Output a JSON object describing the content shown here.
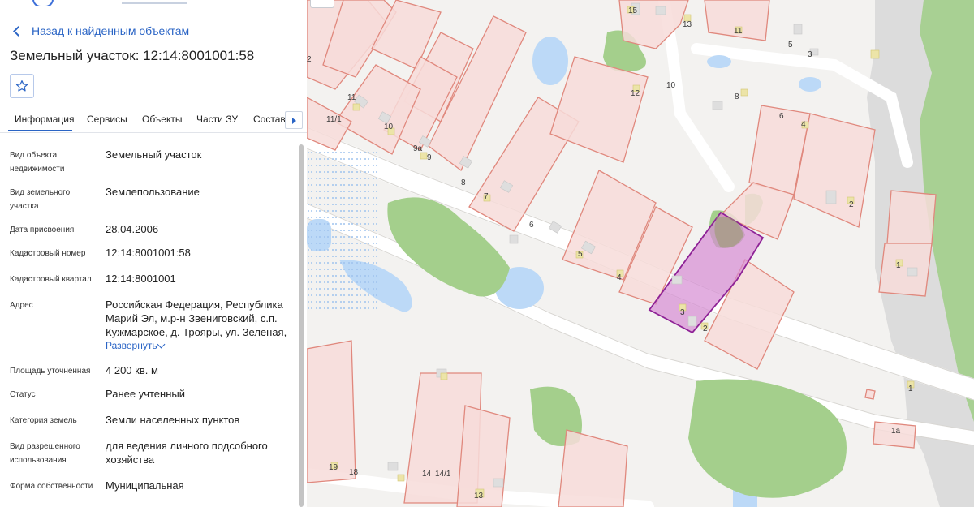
{
  "panel": {
    "back_link": "Назад к найденным объектам",
    "title": "Земельный участок: 12:14:8001001:58",
    "tabs": [
      "Информация",
      "Сервисы",
      "Объекты",
      "Части ЗУ",
      "Состав"
    ],
    "rows": {
      "object_type": {
        "label": "Вид объекта недвижимости",
        "value": "Земельный участок"
      },
      "land_type": {
        "label": "Вид земельного участка",
        "value": "Землепользование"
      },
      "assign_date": {
        "label": "Дата присвоения",
        "value": "28.04.2006"
      },
      "cadastral_number": {
        "label": "Кадастровый номер",
        "value": "12:14:8001001:58"
      },
      "cadastral_quarter": {
        "label": "Кадастровый квартал",
        "value": "12:14:8001001"
      },
      "address": {
        "label": "Адрес",
        "value": "Российская Федерация, Республика Марий Эл, м.р-н Звениговский, с.п. Кужмарское, д. Трояры, ул. Зеленая,",
        "expand": "Развернуть"
      },
      "area": {
        "label": "Площадь уточненная",
        "value": "4 200 кв. м"
      },
      "status": {
        "label": "Статус",
        "value": "Ранее учтенный"
      },
      "land_category": {
        "label": "Категория земель",
        "value": "Земли населенных пунктов"
      },
      "permitted_use": {
        "label": "Вид разрешенного использования",
        "value": "для ведения личного подсобного хозяйства"
      },
      "ownership": {
        "label": "Форма собственности",
        "value": "Муниципальная"
      }
    }
  },
  "map": {
    "selected_parcel_color": "#d58bd3",
    "parcel_outline_color": "#e0887d",
    "parcel_fill_color": "#f7dcd9",
    "water_color": "#bcd9f7",
    "vegetation_color": "#a4cf8c",
    "building_color": "#ece4a8",
    "labels": [
      "15",
      "13",
      "11",
      "2",
      "5",
      "3",
      "10",
      "12",
      "11",
      "10",
      "11/1",
      "8",
      "6",
      "4",
      "9а",
      "9",
      "8",
      "7",
      "6",
      "2",
      "5",
      "4",
      "1",
      "3",
      "2",
      "1",
      "19",
      "18",
      "14",
      "14/1",
      "13",
      "1а"
    ]
  },
  "icons": {
    "back": "chevron-left-icon",
    "favorite": "star-outline-icon",
    "tab_next": "caret-right-icon",
    "expand": "chevron-down-icon"
  }
}
